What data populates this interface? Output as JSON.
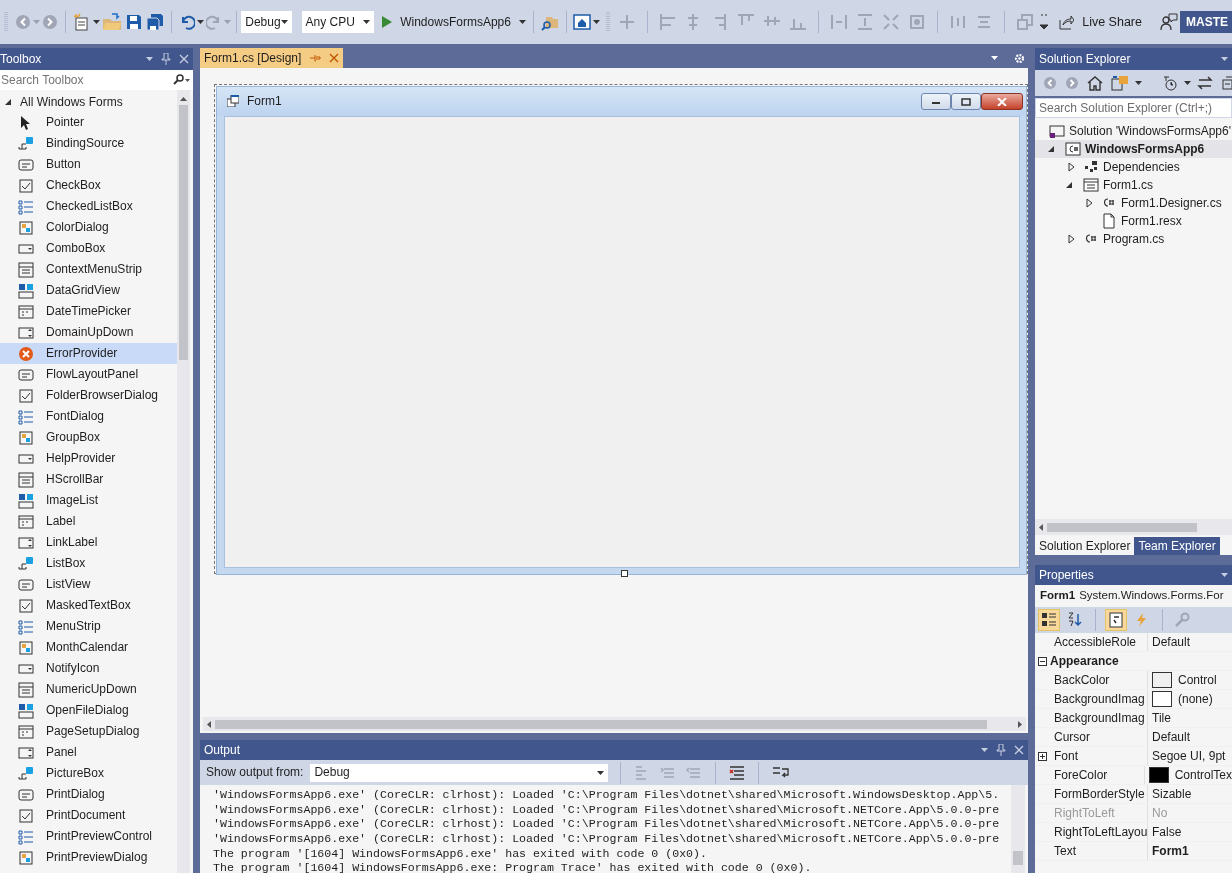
{
  "toolbar": {
    "configuration": "Debug",
    "platform": "Any CPU",
    "start_button": "WindowsFormsApp6",
    "live_share": "Live Share",
    "profile_button": "MASTE"
  },
  "toolbox": {
    "title": "Toolbox",
    "search": {
      "placeholder": "Search Toolbox"
    },
    "group": {
      "label": "All Windows Forms",
      "expanded": true
    },
    "items": [
      {
        "label": "Pointer",
        "selected": false
      },
      {
        "label": "BindingSource",
        "selected": false
      },
      {
        "label": "Button",
        "selected": false
      },
      {
        "label": "CheckBox",
        "selected": false
      },
      {
        "label": "CheckedListBox",
        "selected": false
      },
      {
        "label": "ColorDialog",
        "selected": false
      },
      {
        "label": "ComboBox",
        "selected": false
      },
      {
        "label": "ContextMenuStrip",
        "selected": false
      },
      {
        "label": "DataGridView",
        "selected": false
      },
      {
        "label": "DateTimePicker",
        "selected": false
      },
      {
        "label": "DomainUpDown",
        "selected": false
      },
      {
        "label": "ErrorProvider",
        "selected": true
      },
      {
        "label": "FlowLayoutPanel",
        "selected": false
      },
      {
        "label": "FolderBrowserDialog",
        "selected": false
      },
      {
        "label": "FontDialog",
        "selected": false
      },
      {
        "label": "GroupBox",
        "selected": false
      },
      {
        "label": "HelpProvider",
        "selected": false
      },
      {
        "label": "HScrollBar",
        "selected": false
      },
      {
        "label": "ImageList",
        "selected": false
      },
      {
        "label": "Label",
        "selected": false
      },
      {
        "label": "LinkLabel",
        "selected": false
      },
      {
        "label": "ListBox",
        "selected": false
      },
      {
        "label": "ListView",
        "selected": false
      },
      {
        "label": "MaskedTextBox",
        "selected": false
      },
      {
        "label": "MenuStrip",
        "selected": false
      },
      {
        "label": "MonthCalendar",
        "selected": false
      },
      {
        "label": "NotifyIcon",
        "selected": false
      },
      {
        "label": "NumericUpDown",
        "selected": false
      },
      {
        "label": "OpenFileDialog",
        "selected": false
      },
      {
        "label": "PageSetupDialog",
        "selected": false
      },
      {
        "label": "Panel",
        "selected": false
      },
      {
        "label": "PictureBox",
        "selected": false
      },
      {
        "label": "PrintDialog",
        "selected": false
      },
      {
        "label": "PrintDocument",
        "selected": false
      },
      {
        "label": "PrintPreviewControl",
        "selected": false
      },
      {
        "label": "PrintPreviewDialog",
        "selected": false
      }
    ]
  },
  "document_tabs": [
    {
      "label": "Form1.cs [Design]",
      "selected": true
    }
  ],
  "designer": {
    "form": {
      "title": "Form1"
    }
  },
  "output": {
    "title": "Output",
    "source_label": "Show output from:",
    "source": "Debug",
    "lines": [
      "'WindowsFormsApp6.exe' (CoreCLR: clrhost): Loaded 'C:\\Program Files\\dotnet\\shared\\Microsoft.WindowsDesktop.App\\5.",
      "'WindowsFormsApp6.exe' (CoreCLR: clrhost): Loaded 'C:\\Program Files\\dotnet\\shared\\Microsoft.NETCore.App\\5.0.0-pre",
      "'WindowsFormsApp6.exe' (CoreCLR: clrhost): Loaded 'C:\\Program Files\\dotnet\\shared\\Microsoft.NETCore.App\\5.0.0-pre",
      "'WindowsFormsApp6.exe' (CoreCLR: clrhost): Loaded 'C:\\Program Files\\dotnet\\shared\\Microsoft.NETCore.App\\5.0.0-pre",
      "The program '[1604] WindowsFormsApp6.exe' has exited with code 0 (0x0).",
      "The program '[1604] WindowsFormsApp6.exe: Program Trace' has exited with code 0 (0x0)."
    ]
  },
  "solution_explorer": {
    "title": "Solution Explorer",
    "search": {
      "placeholder": "Search Solution Explorer (Ctrl+;)"
    },
    "tree": [
      {
        "label": "Solution 'WindowsFormsApp6'",
        "kind": "solution",
        "selected": false,
        "children": [
          {
            "label": "WindowsFormsApp6",
            "kind": "project",
            "expanded": true,
            "selected": true,
            "children": [
              {
                "label": "Dependencies",
                "kind": "dependencies",
                "expanded": false,
                "selected": false
              },
              {
                "label": "Form1.cs",
                "kind": "form",
                "expanded": true,
                "selected": false,
                "children": [
                  {
                    "label": "Form1.Designer.cs",
                    "kind": "csharp",
                    "expanded": false,
                    "selected": false
                  },
                  {
                    "label": "Form1.resx",
                    "kind": "resource",
                    "selected": false
                  }
                ]
              },
              {
                "label": "Program.cs",
                "kind": "csharp",
                "expanded": false,
                "selected": false
              }
            ]
          }
        ]
      }
    ],
    "tabs": [
      {
        "label": "Solution Explorer",
        "selected": true
      },
      {
        "label": "Team Explorer",
        "selected": false
      }
    ]
  },
  "properties": {
    "title": "Properties",
    "object_name": "Form1",
    "object_type": "System.Windows.Forms.For",
    "view_buttons": [
      {
        "kind": "categorized",
        "selected": true
      },
      {
        "kind": "alphabetical",
        "selected": false
      },
      {
        "kind": "properties",
        "selected": true
      },
      {
        "kind": "events",
        "selected": false
      }
    ],
    "rows": [
      {
        "kind": "property",
        "name": "AccessibleRole",
        "value": "Default",
        "disabled": false,
        "modified": false
      },
      {
        "kind": "category",
        "name": "Appearance",
        "expanded": true
      },
      {
        "kind": "property",
        "name": "BackColor",
        "value": "Control",
        "color": "#f0f0f0",
        "disabled": false,
        "modified": false
      },
      {
        "kind": "property",
        "name": "BackgroundImag",
        "value": "(none)",
        "color": "#ffffff",
        "disabled": false,
        "modified": false
      },
      {
        "kind": "property",
        "name": "BackgroundImag",
        "value": "Tile",
        "disabled": false,
        "modified": false
      },
      {
        "kind": "property",
        "name": "Cursor",
        "value": "Default",
        "disabled": false,
        "modified": false
      },
      {
        "kind": "property",
        "name": "Font",
        "value": "Segoe UI, 9pt",
        "expanded": false,
        "disabled": false,
        "modified": false
      },
      {
        "kind": "property",
        "name": "ForeColor",
        "value": "ControlTex",
        "color": "#000000",
        "disabled": false,
        "modified": false
      },
      {
        "kind": "property",
        "name": "FormBorderStyle",
        "value": "Sizable",
        "disabled": false,
        "modified": false
      },
      {
        "kind": "property",
        "name": "RightToLeft",
        "value": "No",
        "disabled": true,
        "modified": false
      },
      {
        "kind": "property",
        "name": "RightToLeftLayou",
        "value": "False",
        "disabled": false,
        "modified": false
      },
      {
        "kind": "property",
        "name": "Text",
        "value": "Form1",
        "disabled": false,
        "modified": true
      }
    ]
  }
}
